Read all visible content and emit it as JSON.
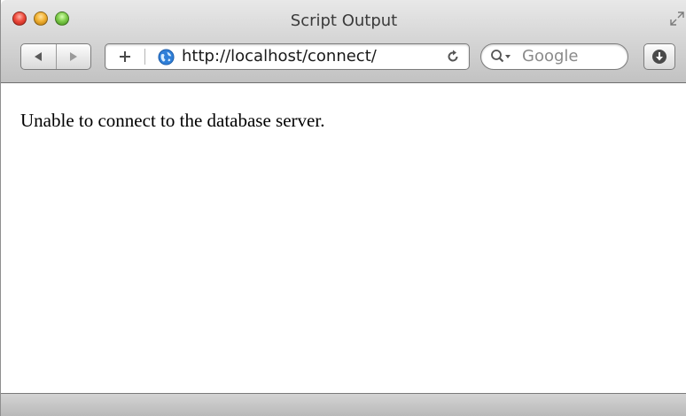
{
  "window": {
    "title": "Script Output"
  },
  "toolbar": {
    "back_icon": "back-arrow-icon",
    "forward_icon": "forward-arrow-icon",
    "add_icon": "plus-icon",
    "address": {
      "url": "http://localhost/connect/",
      "icon": "globe-icon"
    },
    "reload_icon": "reload-icon",
    "search": {
      "placeholder": "Google",
      "icon": "search-icon"
    },
    "download_icon": "download-icon"
  },
  "page": {
    "message": "Unable to connect to the database server."
  },
  "colors": {
    "close": "#ee4b3d",
    "minimize": "#f2b233",
    "maximize": "#7fcd4b",
    "globe": "#2f7fd8"
  }
}
